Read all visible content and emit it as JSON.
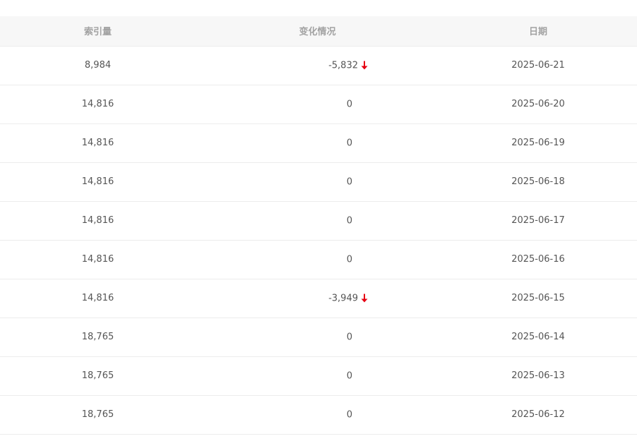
{
  "columns": {
    "index_count": "索引量",
    "change": "变化情况",
    "date": "日期"
  },
  "colors": {
    "down_arrow": "#e60012",
    "header_bg": "#f7f7f7",
    "header_text": "#a2a2a2",
    "cell_text": "#555555"
  },
  "rows": [
    {
      "index_count": "8,984",
      "change": "-5,832",
      "trend": "down",
      "date": "2025-06-21"
    },
    {
      "index_count": "14,816",
      "change": "0",
      "trend": "none",
      "date": "2025-06-20"
    },
    {
      "index_count": "14,816",
      "change": "0",
      "trend": "none",
      "date": "2025-06-19"
    },
    {
      "index_count": "14,816",
      "change": "0",
      "trend": "none",
      "date": "2025-06-18"
    },
    {
      "index_count": "14,816",
      "change": "0",
      "trend": "none",
      "date": "2025-06-17"
    },
    {
      "index_count": "14,816",
      "change": "0",
      "trend": "none",
      "date": "2025-06-16"
    },
    {
      "index_count": "14,816",
      "change": "-3,949",
      "trend": "down",
      "date": "2025-06-15"
    },
    {
      "index_count": "18,765",
      "change": "0",
      "trend": "none",
      "date": "2025-06-14"
    },
    {
      "index_count": "18,765",
      "change": "0",
      "trend": "none",
      "date": "2025-06-13"
    },
    {
      "index_count": "18,765",
      "change": "0",
      "trend": "none",
      "date": "2025-06-12"
    }
  ]
}
